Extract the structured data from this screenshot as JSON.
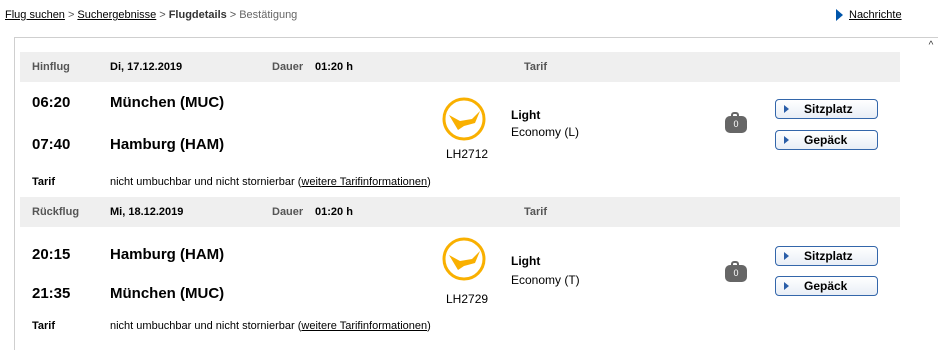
{
  "breadcrumb": {
    "step1": "Flug suchen",
    "step2": "Suchergebnisse",
    "step3": "Flugdetails",
    "step4": "Bestätigung",
    "separator": ">"
  },
  "news_link": "Nachrichte",
  "scroll_up": "^",
  "labels": {
    "duration": "Dauer",
    "tariff": "Tarif",
    "seat_button": "Sitzplatz",
    "baggage_button": "Gepäck",
    "tariff_text": "nicht umbuchbar und nicht stornierbar (",
    "tariff_link": "weitere Tarifinformationen",
    "tariff_close": ")"
  },
  "outbound": {
    "label": "Hinflug",
    "date": "Di, 17.12.2019",
    "duration": "01:20 h",
    "dep_time": "06:20",
    "dep_city": "München (MUC)",
    "arr_time": "07:40",
    "arr_city": "Hamburg (HAM)",
    "flight_no": "LH2712",
    "tariff_name": "Light",
    "tariff_class": "Economy (L)",
    "bag_count": "0"
  },
  "return": {
    "label": "Rückflug",
    "date": "Mi, 18.12.2019",
    "duration": "01:20 h",
    "dep_time": "20:15",
    "dep_city": "Hamburg (HAM)",
    "arr_time": "21:35",
    "arr_city": "München (MUC)",
    "flight_no": "LH2729",
    "tariff_name": "Light",
    "tariff_class": "Economy (T)",
    "bag_count": "0"
  },
  "colors": {
    "accent": "#f9b000",
    "link_blue": "#2a5ea8"
  },
  "icons": {
    "airline_logo": "lufthansa-crane-icon",
    "baggage": "suitcase-icon",
    "play": "triangle-right-icon"
  }
}
